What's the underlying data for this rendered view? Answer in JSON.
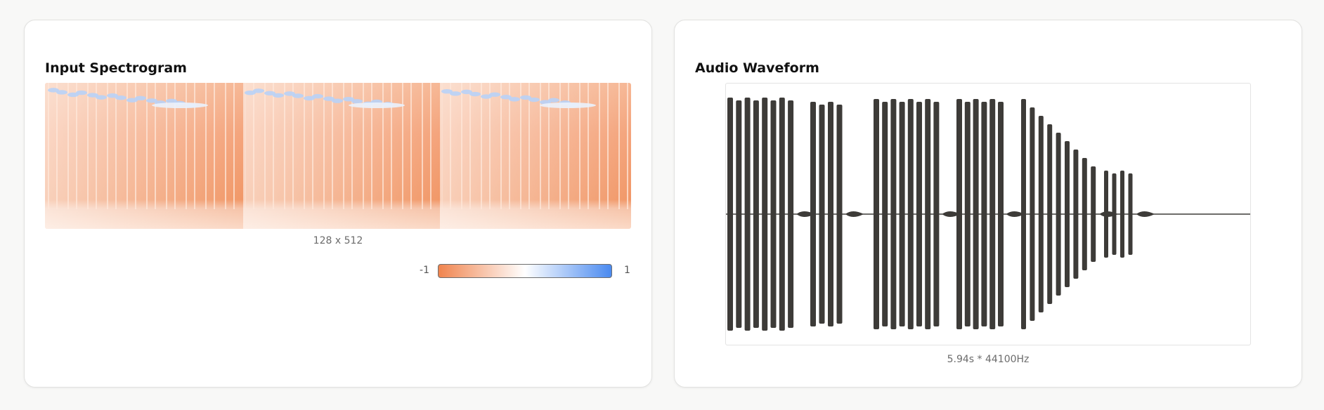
{
  "spectrogram_panel": {
    "title": "Input Spectrogram",
    "dimensions": "128 x 512",
    "colorbar": {
      "min_label": "-1",
      "max_label": "1",
      "low_color": "#f0844e",
      "mid_color": "#ffffff",
      "high_color": "#4a8af0"
    }
  },
  "waveform_panel": {
    "title": "Audio Waveform",
    "duration_label": "5.94s * 44100Hz",
    "wave_color": "#3d3b38"
  }
}
